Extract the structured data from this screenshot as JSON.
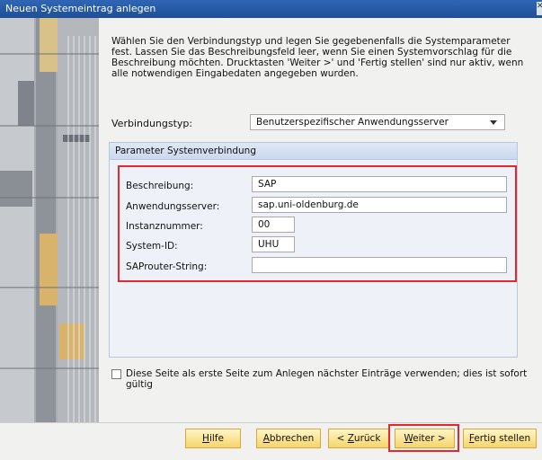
{
  "window": {
    "title": "Neuen Systemeintrag anlegen"
  },
  "intro_text": "Wählen Sie den Verbindungstyp und legen Sie gegebenenfalls die Systemparameter fest. Lassen Sie das Beschreibungsfeld leer, wenn Sie einen Systemvorschlag für die Beschreibung möchten. Drucktasten 'Weiter >' und 'Fertig stellen' sind nur aktiv, wenn alle notwendigen Eingabedaten angegeben wurden.",
  "connection_type": {
    "label": "Verbindungstyp:",
    "value": "Benutzerspezifischer Anwendungsserver"
  },
  "params_group": {
    "title": "Parameter Systemverbindung"
  },
  "fields": {
    "beschreibung": {
      "label": "Beschreibung:",
      "value": "SAP"
    },
    "anwendungsserver": {
      "label": "Anwendungsserver:",
      "value": "sap.uni-oldenburg.de"
    },
    "instanznummer": {
      "label": "Instanznummer:",
      "value": "00"
    },
    "system_id": {
      "label": "System-ID:",
      "value": "UHU"
    },
    "saprouter": {
      "label": "SAProuter-String:",
      "value": ""
    }
  },
  "checkbox": {
    "label": "Diese Seite als erste Seite zum Anlegen nächster Einträge verwenden; dies ist sofort gültig",
    "checked": false
  },
  "buttons": {
    "hilfe": {
      "pre": "",
      "ul": "H",
      "post": "ilfe"
    },
    "abbrechen": {
      "pre": "",
      "ul": "A",
      "post": "bbrechen"
    },
    "zurueck": {
      "pre": "< ",
      "ul": "Z",
      "post": "urück"
    },
    "weiter": {
      "pre": "",
      "ul": "W",
      "post": "eiter >"
    },
    "fertig": {
      "pre": "",
      "ul": "F",
      "post": "ertig stellen"
    }
  },
  "colors": {
    "title_bar": "#2a5fad",
    "highlight": "#e3292f",
    "button": "#f5d56a"
  }
}
